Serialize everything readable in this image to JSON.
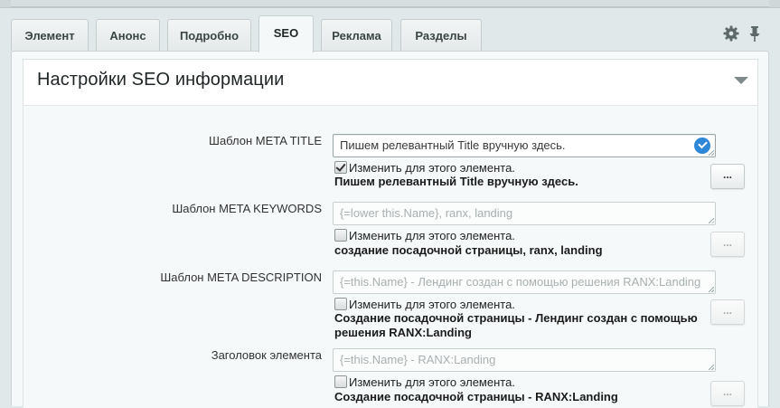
{
  "tabs": [
    {
      "label": "Элемент",
      "active": false
    },
    {
      "label": "Анонс",
      "active": false
    },
    {
      "label": "Подробно",
      "active": false
    },
    {
      "label": "SEO",
      "active": true
    },
    {
      "label": "Реклама",
      "active": false
    },
    {
      "label": "Разделы",
      "active": false
    }
  ],
  "toolbar": {
    "settings_icon": "gear-icon",
    "pin_icon": "pin-icon"
  },
  "section": {
    "title": "Настройки SEO информации"
  },
  "rows": [
    {
      "label": "Шаблон META TITLE",
      "value": "Пишем релевантный Title вручную здесь.",
      "editable": true,
      "checkbox_label": "Изменить для этого элемента.",
      "checked": true,
      "preview": "Пишем релевантный Title вручную здесь.",
      "button_label": "..."
    },
    {
      "label": "Шаблон META KEYWORDS",
      "value": "{=lower this.Name}, ranx, landing",
      "editable": false,
      "checkbox_label": "Изменить для этого элемента.",
      "checked": false,
      "preview": "создание посадочной страницы, ranx, landing",
      "button_label": "..."
    },
    {
      "label": "Шаблон META DESCRIPTION",
      "value": "{=this.Name} - Лендинг создан с помощью решения RANX:Landing",
      "editable": false,
      "checkbox_label": "Изменить для этого элемента.",
      "checked": false,
      "preview": "Создание посадочной страницы - Лендинг создан с помощью решения RANX:Landing",
      "button_label": "..."
    },
    {
      "label": "Заголовок элемента",
      "value": "{=this.Name} - RANX:Landing",
      "editable": false,
      "checkbox_label": "Изменить для этого элемента.",
      "checked": false,
      "preview": "Создание посадочной страницы - RANX:Landing",
      "button_label": "..."
    }
  ]
}
